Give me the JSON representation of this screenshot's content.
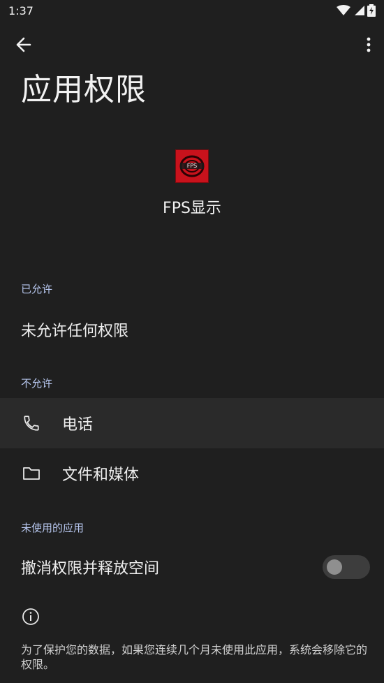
{
  "status_bar": {
    "time": "1:37"
  },
  "page": {
    "title": "应用权限"
  },
  "app": {
    "name": "FPS显示",
    "icon_text": "FPS显示"
  },
  "allowed": {
    "header": "已允许",
    "empty_text": "未允许任何权限"
  },
  "denied": {
    "header": "不允许",
    "items": [
      {
        "label": "电话",
        "icon": "phone-icon"
      },
      {
        "label": "文件和媒体",
        "icon": "folder-icon"
      }
    ]
  },
  "unused": {
    "header": "未使用的应用",
    "toggle_label": "撤消权限并释放空间",
    "toggle_on": false
  },
  "footer": {
    "info_icon": "info-icon",
    "text": "为了保护您的数据，如果您连续几个月未使用此应用，系统会移除它的权限。"
  },
  "colors": {
    "background": "#1f1f1f",
    "section_header": "#b8c8f0",
    "app_icon_bg": "#c8121c"
  }
}
